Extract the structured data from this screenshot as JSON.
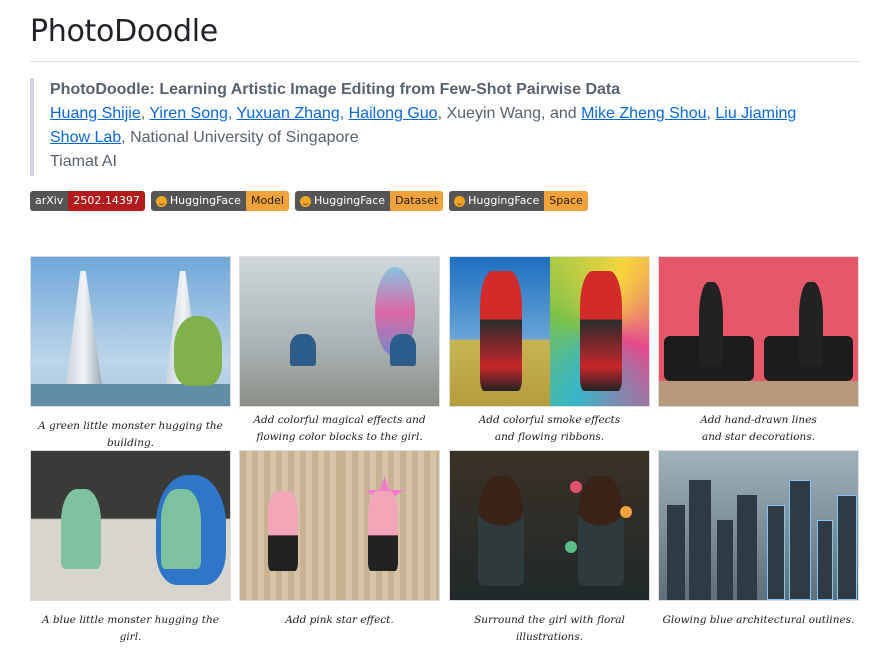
{
  "page": {
    "title": "PhotoDoodle"
  },
  "paper": {
    "title": "PhotoDoodle: Learning Artistic Image Editing from Few-Shot Pairwise Data",
    "authors": [
      {
        "name": "Huang Shijie",
        "link": true
      },
      {
        "name": "Yiren Song",
        "link": true
      },
      {
        "name": "Yuxuan Zhang",
        "link": true
      },
      {
        "name": "Hailong Guo",
        "link": true
      },
      {
        "name": "Xueyin Wang",
        "link": false
      },
      {
        "name": "Mike Zheng Shou",
        "link": true
      },
      {
        "name": "Liu Jiaming",
        "link": true
      }
    ],
    "sep_comma": ", ",
    "sep_and": ", and ",
    "affiliation_link": "Show Lab",
    "affiliation_rest": ", National University of Singapore",
    "affiliation2": "Tiamat AI"
  },
  "badges": [
    {
      "left": "arXiv",
      "right": "2502.14397",
      "style": "red",
      "icon": null
    },
    {
      "left": "HuggingFace",
      "right": "Model",
      "style": "yellow",
      "icon": "huggingface-icon"
    },
    {
      "left": "HuggingFace",
      "right": "Dataset",
      "style": "yellow",
      "icon": "huggingface-icon"
    },
    {
      "left": "HuggingFace",
      "right": "Space",
      "style": "yellow",
      "icon": "huggingface-icon"
    }
  ],
  "examples": [
    {
      "caption": [
        "A green little monster hugging the building."
      ]
    },
    {
      "caption": [
        "Add colorful magical effects and",
        "flowing color blocks to the girl."
      ]
    },
    {
      "caption": [
        "Add colorful smoke effects",
        "and flowing ribbons."
      ]
    },
    {
      "caption": [
        "Add hand-drawn lines",
        "and star decorations."
      ]
    },
    {
      "caption": [
        "A blue little monster hugging the girl."
      ]
    },
    {
      "caption": [
        "Add pink star effect."
      ]
    },
    {
      "caption": [
        "Surround the girl with floral illustrations."
      ]
    },
    {
      "caption": [
        "Glowing blue architectural outlines."
      ]
    }
  ],
  "colors": {
    "link": "#0969da",
    "arxiv": "#b31b1b",
    "hf": "#f1a33b"
  }
}
